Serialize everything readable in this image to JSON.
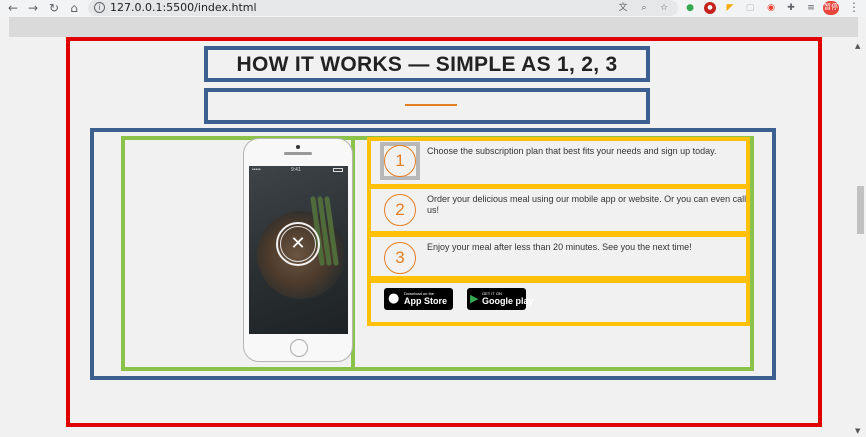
{
  "browser": {
    "url": "127.0.0.1:5500/index.html",
    "profile_label": "暂停",
    "nav_icons": [
      "back-arrow-icon",
      "forward-arrow-icon",
      "reload-icon",
      "home-icon"
    ],
    "extension_icons": [
      "translate-icon",
      "zoom-icon",
      "bookmark-star-icon",
      "extension-a-icon",
      "extension-b-icon",
      "extension-c-icon",
      "extension-d-icon",
      "extension-e-icon",
      "extensions-puzzle-icon"
    ]
  },
  "section": {
    "title": "HOW IT WORKS — SIMPLE AS 1, 2, 3",
    "accent_color": "#e67e22"
  },
  "steps": [
    {
      "number": "1",
      "text": "Choose the subscription plan that best fits your needs and sign up today."
    },
    {
      "number": "2",
      "text": "Order your delicious meal using our mobile app or website. Or you can even call us!"
    },
    {
      "number": "3",
      "text": "Enjoy your meal after less than 20 minutes. See you the next time!"
    }
  ],
  "stores": {
    "appstore": {
      "small": "Download on the",
      "big": "App Store"
    },
    "googleplay": {
      "small": "GET IT ON",
      "big": "Google play"
    }
  },
  "phone": {
    "time": "9:41"
  },
  "colors": {
    "outline_red": "#e00000",
    "outline_blue": "#3b5f8f",
    "outline_green": "#8bc34a",
    "outline_yellow": "#ffc107",
    "outline_grey": "#b8b8b8"
  }
}
